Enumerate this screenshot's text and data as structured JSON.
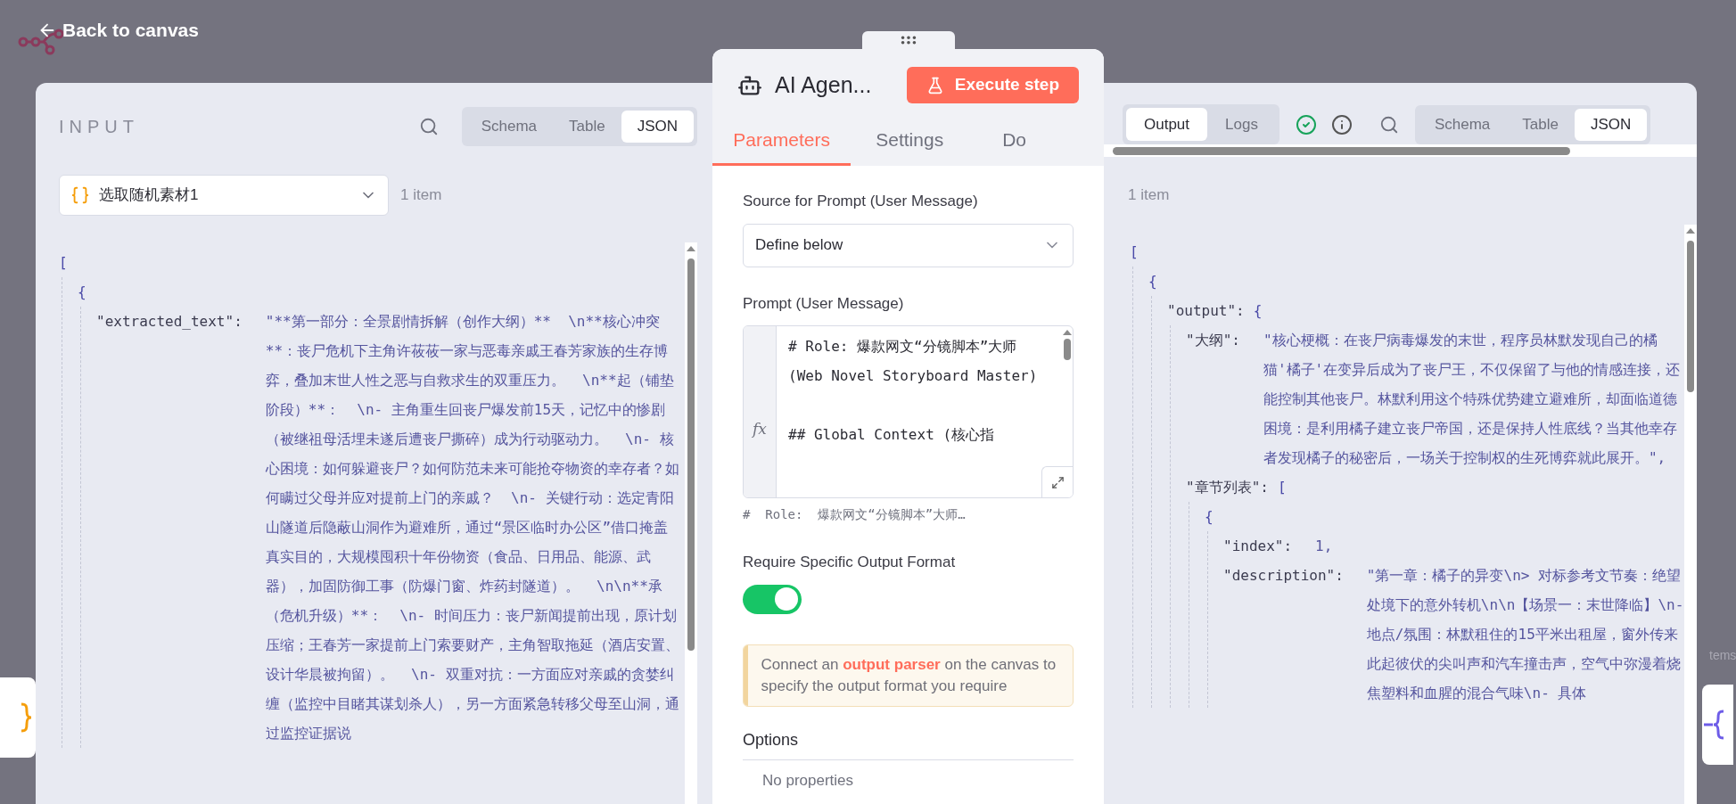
{
  "header": {
    "back_link": "Back to canvas"
  },
  "input_panel": {
    "title": "INPUT",
    "view_tabs": [
      {
        "label": "Schema",
        "selected": false
      },
      {
        "label": "Table",
        "selected": false
      },
      {
        "label": "JSON",
        "selected": true
      }
    ],
    "node_select": {
      "value": "选取随机素材1"
    },
    "item_count": "1 item",
    "json": {
      "open": "[",
      "children": [
        {
          "open": "{",
          "children": [
            {
              "key": "\"extracted_text\":",
              "value": "\"**第一部分：全景剧情拆解（创作大纲）**  \\n**核心冲突**：丧尸危机下主角许莜莜一家与恶毒亲戚王春芳家族的生存博弈，叠加末世人性之恶与自救求生的双重压力。  \\n**起（铺垫阶段）**：  \\n- 主角重生回丧尸爆发前15天，记忆中的惨剧（被继祖母活埋未遂后遭丧尸撕碎）成为行动驱动力。  \\n- 核心困境：如何躲避丧尸？如何防范未来可能抢夺物资的幸存者？如何瞒过父母并应对提前上门的亲戚？  \\n- 关键行动：选定青阳山隧道后隐蔽山洞作为避难所，通过“景区临时办公区”借口掩盖真实目的，大规模囤积十年份物资（食品、日用品、能源、武器），加固防御工事（防爆门窗、炸药封隧道）。  \\n\\n**承（危机升级）**：  \\n- 时间压力：丧尸新闻提前出现，原计划压缩；王春芳一家提前上门索要财产，主角智取拖延（酒店安置、设计华晨被拘留）。  \\n- 双重对抗：一方面应对亲戚的贪婪纠缠（监控中目睹其谋划杀人），另一方面紧急转移父母至山洞，通过监控证据说"
            }
          ]
        }
      ]
    }
  },
  "node_panel": {
    "title": "AI Agen...",
    "execute_button": "Execute step",
    "tabs": [
      {
        "label": "Parameters",
        "selected": true
      },
      {
        "label": "Settings",
        "selected": false
      },
      {
        "label": "Do",
        "selected": false
      }
    ],
    "source_label": "Source for Prompt (User Message)",
    "source_select": {
      "value": "Define below"
    },
    "prompt_label": "Prompt (User Message)",
    "prompt_editor": {
      "gutter": "fx",
      "value": "# Role: 爆款网文“分镜脚本”大师 (Web Novel Storyboard Master)\n\n## Global Context (核心指"
    },
    "prompt_preview": "#  Role:  爆款网文“分镜脚本”大师…",
    "output_format_label": "Require Specific Output Format",
    "output_format_toggle": {
      "on": true
    },
    "notice": "Connect an **output parser** on the canvas to specify the output format you require",
    "options_heading": "Options",
    "options_empty": "No properties"
  },
  "output_panel": {
    "mode_tabs": [
      {
        "label": "Output",
        "selected": true
      },
      {
        "label": "Logs",
        "selected": false
      }
    ],
    "view_tabs": [
      {
        "label": "Schema",
        "selected": false
      },
      {
        "label": "Table",
        "selected": false
      },
      {
        "label": "JSON",
        "selected": true
      }
    ],
    "item_count": "1 item",
    "json": {
      "open": "[",
      "children": [
        {
          "open": "{",
          "children": [
            {
              "key": "\"output\":",
              "open": "{",
              "children": [
                {
                  "key": "\"大纲\":",
                  "value": "\"核心梗概：在丧尸病毒爆发的末世，程序员林默发现自己的橘猫'橘子'在变异后成为了丧尸王，不仅保留了与他的情感连接，还能控制其他丧尸。林默利用这个特殊优势建立避难所，却面临道德困境：是利用橘子建立丧尸帝国，还是保持人性底线？当其他幸存者发现橘子的秘密后，一场关于控制权的生死博弈就此展开。\","
                },
                {
                  "key": "\"章节列表\":",
                  "open": "[",
                  "children": [
                    {
                      "open": "{",
                      "children": [
                        {
                          "key": "\"index\":",
                          "value": "1,"
                        },
                        {
                          "key": "\"description\":",
                          "value": "\"第一章：橘子的异变\\n> 对标参考文节奏：绝望处境下的意外转机\\n\\n【场景一：末世降临】\\n- 地点/氛围：林默租住的15平米出租屋，窗外传来此起彼伏的尖叫声和汽车撞击声，空气中弥漫着烧焦塑料和血腥的混合气味\\n- 具体"
                        }
                      ]
                    }
                  ]
                }
              ]
            }
          ]
        }
      ]
    }
  },
  "canvas_hint": "tems"
}
